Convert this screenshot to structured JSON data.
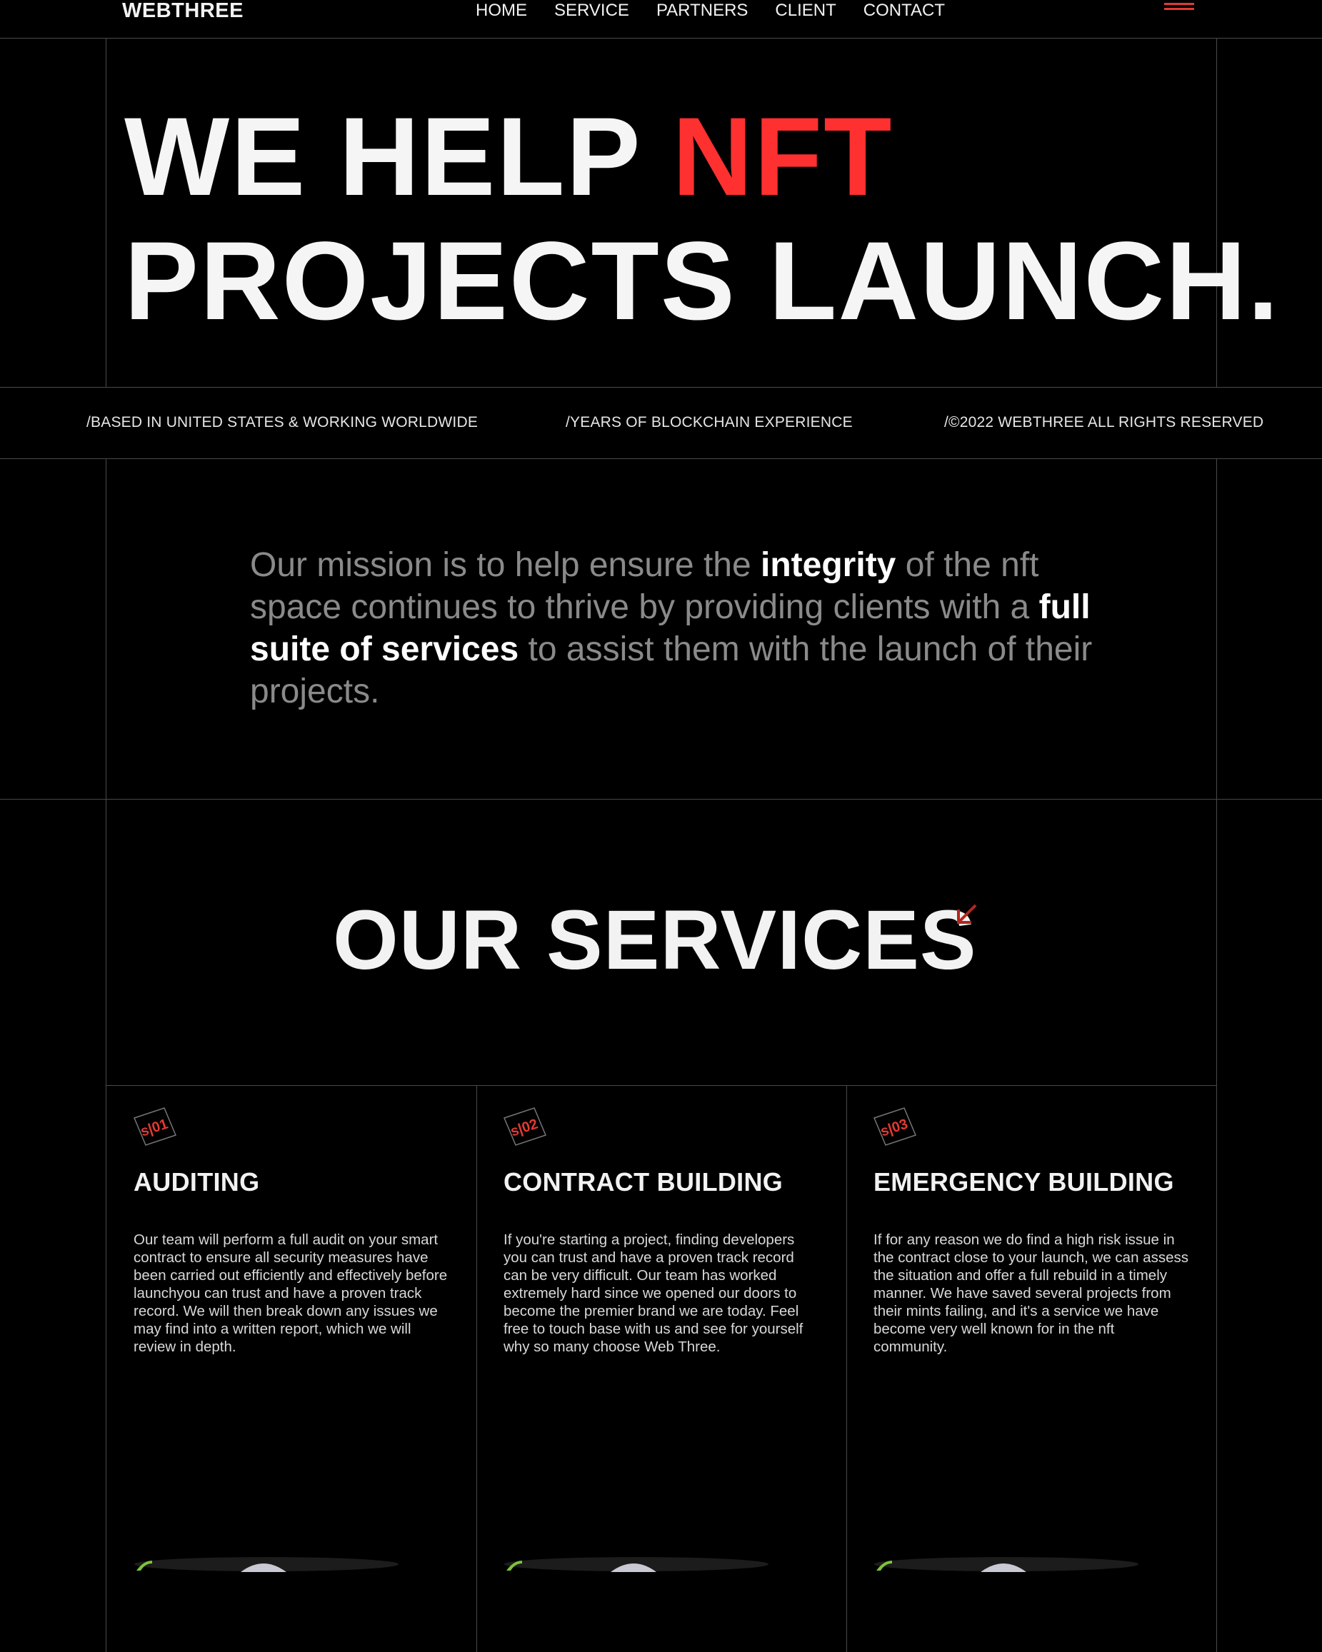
{
  "nav": {
    "logo": "WEBTHREE",
    "links": [
      "HOME",
      "SERVICE",
      "PARTNERS",
      "CLIENT",
      "CONTACT"
    ],
    "menu_icon": "hamburger-icon",
    "accent": "#e23a34"
  },
  "hero": {
    "line1_prefix": "WE HELP ",
    "line1_highlight": "NFT",
    "line2": "PROJECTS LAUNCH.",
    "highlight_color": "#ff3030"
  },
  "info_bar": {
    "left": "/BASED IN UNITED STATES & WORKING WORLDWIDE",
    "middle": "/YEARS OF BLOCKCHAIN EXPERIENCE",
    "right": "/©2022 WEBTHREE ALL RIGHTS RESERVED"
  },
  "mission": {
    "part1": "Our mission is to help ensure the ",
    "bold1": "integrity",
    "part2": " of the nft space continues to thrive by providing clients with a ",
    "bold2": "full suite of services",
    "part3": " to assist them with the launch of their projects."
  },
  "services": {
    "title": "OUR SERVICES",
    "arrow_icon": "arrow-down-left-icon",
    "cards": [
      {
        "badge": "s|01",
        "title": "AUDITING",
        "text": "Our team will perform a full audit on your smart contract to ensure all security measures have been carried out efficiently and effectively before launchyou can trust and have a proven track record. We will then break down any issues we may find into a written report, which we will review in depth."
      },
      {
        "badge": "s|02",
        "title": "CONTRACT BUILDING",
        "text": "If you're starting a project, finding developers you can trust and have a proven track record can be very difficult. Our team has worked extremely hard since we opened our doors to become the premier brand we are today. Feel free to touch base with us and see for yourself why so many choose Web Three."
      },
      {
        "badge": "s|03",
        "title": "EMERGENCY BUILDING",
        "text": "If for any reason we do find a high risk issue in the contract close to your launch, we can assess the situation and offer a full rebuild in a timely manner. We have saved several projects from their mints failing, and it's a service we have become very well known for in the nft community."
      }
    ]
  }
}
